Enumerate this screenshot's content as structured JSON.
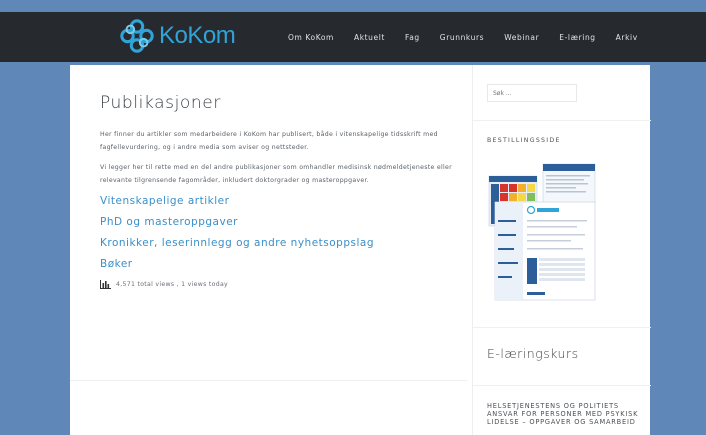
{
  "header": {
    "logo_text": "KoKom",
    "nav": [
      "Om KoKom",
      "Aktuelt",
      "Fag",
      "Grunnkurs",
      "Webinar",
      "E-læring",
      "Arkiv"
    ]
  },
  "colors": {
    "page_background": "#5f87b8",
    "header_background": "#262a2f",
    "accent_link": "#3a8fc8",
    "logo_blue": "#2fa4d8"
  },
  "main": {
    "title": "Publikasjoner",
    "paragraphs": [
      "Her finner du artikler som medarbeidere i KoKom har publisert, både i vitenskapelige tidsskrift med fagfellevurdering, og i andre media som aviser og nettsteder.",
      "Vi legger her til rette med en del andre publikasjoner som omhandler medisinsk nødmeldetjeneste eller relevante tilgrensende fagområder, inkludert doktorgrader og masteroppgaver."
    ],
    "categories": [
      "Vitenskapelige artikler",
      "PhD og masteroppgaver",
      "Kronikker, leserinnlegg og andre nyhetsoppslag",
      "Bøker"
    ],
    "views_text": "4,571 total views , 1 views today"
  },
  "sidebar": {
    "search_placeholder": "Søk ...",
    "bestilling_title": "BESTILLINGSSIDE",
    "elearning_title": "E-læringskurs",
    "course_link": "HELSETJENESTENS OG POLITIETS ANSVAR FOR PERSONER MED PSYKISK LIDELSE – OPPGAVER OG SAMARBEID"
  }
}
